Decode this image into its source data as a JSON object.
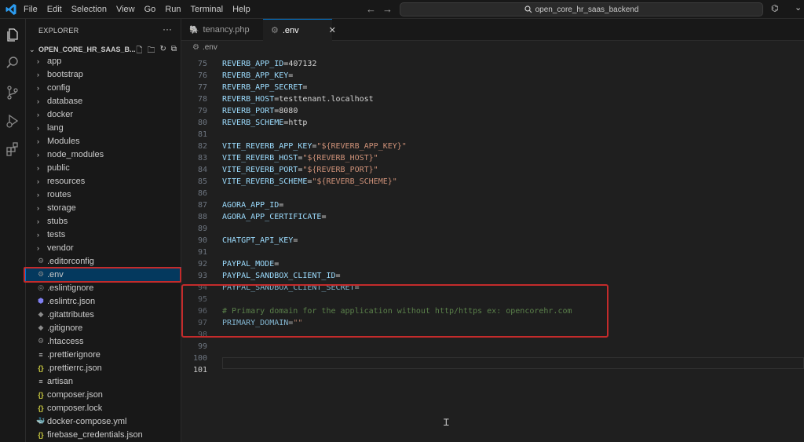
{
  "titlebar": {
    "menus": [
      "File",
      "Edit",
      "Selection",
      "View",
      "Go",
      "Run",
      "Terminal",
      "Help"
    ],
    "search_text": "open_core_hr_saas_backend"
  },
  "sidebar": {
    "title": "EXPLORER",
    "project": "OPEN_CORE_HR_SAAS_B...",
    "folders": [
      "app",
      "bootstrap",
      "config",
      "database",
      "docker",
      "lang",
      "Modules",
      "node_modules",
      "public",
      "resources",
      "routes",
      "storage",
      "stubs",
      "tests",
      "vendor"
    ],
    "files": [
      {
        "name": ".editorconfig",
        "icon": "gear-icon",
        "color": "#8c8c8c"
      },
      {
        "name": ".env",
        "icon": "gear-icon",
        "color": "#8c8c8c",
        "selected": true
      },
      {
        "name": ".eslintignore",
        "icon": "circle-icon",
        "color": "#8c8c8c"
      },
      {
        "name": ".eslintrc.json",
        "icon": "eslint-icon",
        "color": "#8080f2"
      },
      {
        "name": ".gitattributes",
        "icon": "git-icon",
        "color": "#8c8c8c"
      },
      {
        "name": ".gitignore",
        "icon": "git-icon",
        "color": "#8c8c8c"
      },
      {
        "name": ".htaccess",
        "icon": "gear-icon",
        "color": "#8c8c8c"
      },
      {
        "name": ".prettierignore",
        "icon": "lines-icon",
        "color": "#cccccc"
      },
      {
        "name": ".prettierrc.json",
        "icon": "json-icon",
        "color": "#cbcb41"
      },
      {
        "name": "artisan",
        "icon": "lines-icon",
        "color": "#cccccc"
      },
      {
        "name": "composer.json",
        "icon": "json-icon",
        "color": "#cbcb41"
      },
      {
        "name": "composer.lock",
        "icon": "json-icon",
        "color": "#cbcb41"
      },
      {
        "name": "docker-compose.yml",
        "icon": "docker-icon",
        "color": "#e44d60"
      },
      {
        "name": "firebase_credentials.json",
        "icon": "json-icon",
        "color": "#cbcb41"
      }
    ]
  },
  "tabs": [
    {
      "label": "tenancy.php",
      "icon": "php-icon",
      "active": false
    },
    {
      "label": ".env",
      "icon": "gear-icon",
      "active": true
    }
  ],
  "breadcrumb": ".env",
  "editor": {
    "lines": [
      {
        "n": "75",
        "key": "REVERB_APP_ID",
        "val": "407132"
      },
      {
        "n": "76",
        "key": "REVERB_APP_KEY",
        "val": ""
      },
      {
        "n": "77",
        "key": "REVERB_APP_SECRET",
        "val": ""
      },
      {
        "n": "78",
        "key": "REVERB_HOST",
        "val": "testtenant.localhost"
      },
      {
        "n": "79",
        "key": "REVERB_PORT",
        "val": "8080"
      },
      {
        "n": "80",
        "key": "REVERB_SCHEME",
        "val": "http"
      },
      {
        "n": "81"
      },
      {
        "n": "82",
        "key": "VITE_REVERB_APP_KEY",
        "str": "\"${REVERB_APP_KEY}\""
      },
      {
        "n": "83",
        "key": "VITE_REVERB_HOST",
        "str": "\"${REVERB_HOST}\""
      },
      {
        "n": "84",
        "key": "VITE_REVERB_PORT",
        "str": "\"${REVERB_PORT}\""
      },
      {
        "n": "85",
        "key": "VITE_REVERB_SCHEME",
        "str": "\"${REVERB_SCHEME}\""
      },
      {
        "n": "86"
      },
      {
        "n": "87",
        "key": "AGORA_APP_ID",
        "val": ""
      },
      {
        "n": "88",
        "key": "AGORA_APP_CERTIFICATE",
        "val": ""
      },
      {
        "n": "89"
      },
      {
        "n": "90",
        "key": "CHATGPT_API_KEY",
        "val": ""
      },
      {
        "n": "91"
      },
      {
        "n": "92",
        "key": "PAYPAL_MODE",
        "val": ""
      },
      {
        "n": "93",
        "key": "PAYPAL_SANDBOX_CLIENT_ID",
        "val": ""
      },
      {
        "n": "94",
        "key": "PAYPAL_SANDBOX_CLIENT_SECRET",
        "val": ""
      },
      {
        "n": "95"
      },
      {
        "n": "96",
        "comment": "# Primary domain for the application without http/https ex: opencorehr.com"
      },
      {
        "n": "97",
        "key": "PRIMARY_DOMAIN",
        "str": "\"\""
      },
      {
        "n": "98"
      },
      {
        "n": "99"
      },
      {
        "n": "100"
      },
      {
        "n": "101",
        "current": true
      }
    ]
  },
  "colors": {
    "highlight_border": "#c42b2b",
    "accent": "#0078d4"
  }
}
